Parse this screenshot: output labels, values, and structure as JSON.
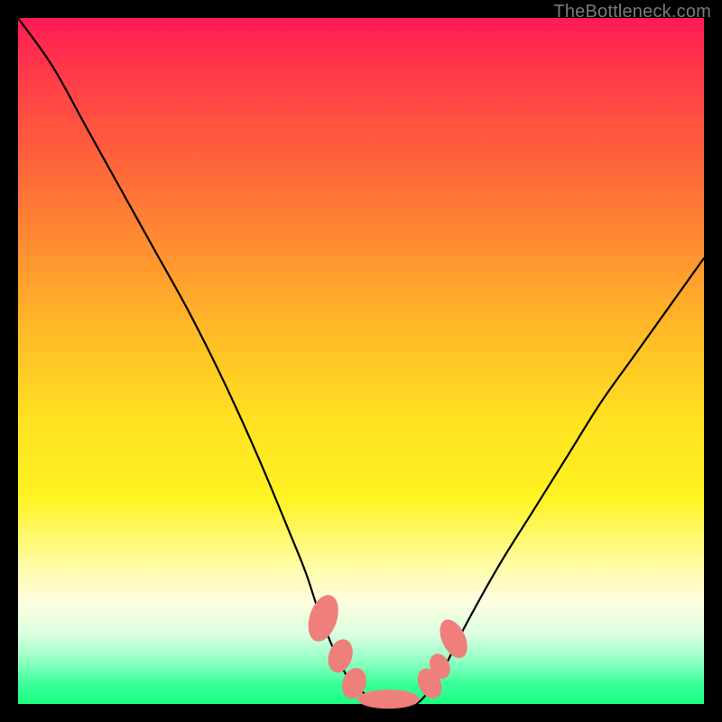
{
  "watermark": "TheBottleneck.com",
  "colors": {
    "curve": "#000000",
    "markers": "#ef7f7a",
    "gradient_top": "#ff1a55",
    "gradient_bottom": "#1aff80",
    "frame": "#000000"
  },
  "chart_data": {
    "type": "line",
    "title": "",
    "xlabel": "",
    "ylabel": "",
    "xlim": [
      0,
      100
    ],
    "ylim": [
      0,
      100
    ],
    "series": [
      {
        "name": "bottleneck-curve",
        "x": [
          0,
          5,
          10,
          15,
          20,
          25,
          30,
          35,
          40,
          42,
          44,
          46,
          48,
          50,
          52,
          54,
          56,
          58,
          60,
          62,
          65,
          70,
          75,
          80,
          85,
          90,
          95,
          100
        ],
        "y": [
          100,
          93,
          84,
          75,
          66,
          57,
          47,
          36,
          24,
          19,
          13,
          8,
          4,
          2,
          0,
          0,
          0,
          0,
          2,
          5,
          11,
          20,
          28,
          36,
          44,
          51,
          58,
          65
        ]
      }
    ],
    "markers": [
      {
        "name": "left-upper",
        "x": 44.5,
        "y": 12.5,
        "rx": 2.0,
        "ry": 3.5,
        "angle": 18
      },
      {
        "name": "left-mid",
        "x": 47.0,
        "y": 7.0,
        "rx": 1.7,
        "ry": 2.5,
        "angle": 18
      },
      {
        "name": "left-lower",
        "x": 49.0,
        "y": 3.0,
        "rx": 1.7,
        "ry": 2.3,
        "angle": 18
      },
      {
        "name": "bottom",
        "x": 54.0,
        "y": 0.7,
        "rx": 4.5,
        "ry": 1.4,
        "angle": 0
      },
      {
        "name": "right-lower",
        "x": 60.0,
        "y": 3.0,
        "rx": 1.6,
        "ry": 2.3,
        "angle": -25
      },
      {
        "name": "right-mid",
        "x": 61.5,
        "y": 5.5,
        "rx": 1.4,
        "ry": 1.9,
        "angle": -25
      },
      {
        "name": "right-upper",
        "x": 63.5,
        "y": 9.5,
        "rx": 1.7,
        "ry": 3.0,
        "angle": -25
      }
    ],
    "grid": false,
    "legend": false
  }
}
